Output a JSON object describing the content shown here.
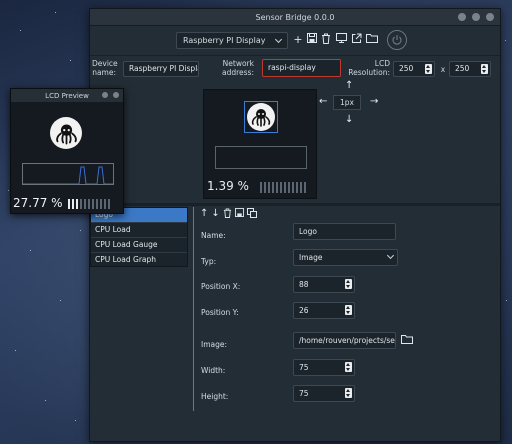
{
  "main_window": {
    "title": "Sensor Bridge 0.0.0",
    "toolbar": {
      "display_select": "Raspberry PI Display",
      "add_icon": "plus-icon",
      "save_icon": "save-icon",
      "delete_icon": "trash-icon",
      "monitor_icon": "monitor-icon",
      "export_icon": "export-icon",
      "open_icon": "folder-icon",
      "power_icon": "power-icon"
    },
    "config": {
      "device_name_label": "Device\nname:",
      "device_name": "Raspberry PI Display",
      "network_label": "Network\naddress:",
      "network_address": "raspi-display",
      "lcd_label": "LCD\nResolution:",
      "res_width": "250",
      "res_sep": "x",
      "res_height": "250"
    },
    "preview": {
      "percent": "1.39 %",
      "step": "1px"
    },
    "widget_list": [
      "Logo",
      "CPU Load",
      "CPU Load Gauge",
      "CPU Load Graph"
    ],
    "properties": {
      "name_label": "Name:",
      "name": "Logo",
      "type_label": "Typ:",
      "type": "Image",
      "posx_label": "Position X:",
      "posx": "88",
      "posy_label": "Position Y:",
      "posy": "26",
      "image_label": "Image:",
      "image": "/home/rouven/projects/sensor",
      "width_label": "Width:",
      "width": "75",
      "height_label": "Height:",
      "height": "75"
    }
  },
  "lcd_window": {
    "title": "LCD Preview",
    "percent": "27.77 %"
  },
  "colors": {
    "accent": "#3b78c6",
    "error_border": "#c0392b",
    "graph_line": "#3a6fd8"
  }
}
